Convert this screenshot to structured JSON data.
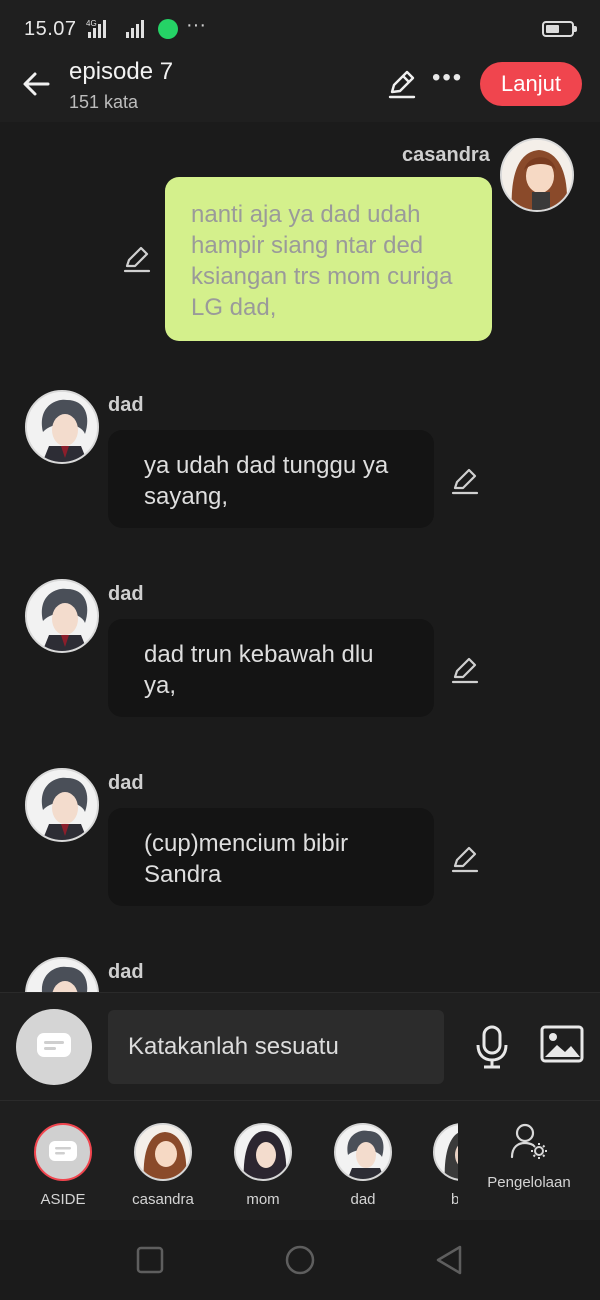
{
  "status_bar": {
    "time": "15.07",
    "network_label": "4G",
    "more_indicator": "···",
    "app_icon": "whatsapp-icon"
  },
  "header": {
    "title": "episode 7",
    "subtitle": "151 kata",
    "continue_label": "Lanjut",
    "accent_color": "#f0454e"
  },
  "messages": [
    {
      "speaker": "casandra",
      "side": "right",
      "text": "nanti aja ya dad udah hampir siang ntar ded ksiangan trs mom curiga LG dad,"
    },
    {
      "speaker": "dad",
      "side": "left",
      "text": "ya udah dad tunggu ya sayang,"
    },
    {
      "speaker": "dad",
      "side": "left",
      "text": "dad trun kebawah dlu ya,"
    },
    {
      "speaker": "dad",
      "side": "left",
      "text": "(cup)mencium bibir Sandra"
    },
    {
      "speaker": "dad",
      "side": "left",
      "text": ""
    }
  ],
  "input": {
    "placeholder": "Katakanlah sesuatu"
  },
  "characters": [
    {
      "label": "ASIDE",
      "selected": true
    },
    {
      "label": "casandra",
      "selected": false
    },
    {
      "label": "mom",
      "selected": false
    },
    {
      "label": "dad",
      "selected": false
    },
    {
      "label": "b",
      "selected": false
    }
  ],
  "manage": {
    "label": "Pengelolaan"
  },
  "colors": {
    "right_bubble": "#d4f08c",
    "left_bubble": "#141414",
    "background": "#1b1b1b"
  }
}
